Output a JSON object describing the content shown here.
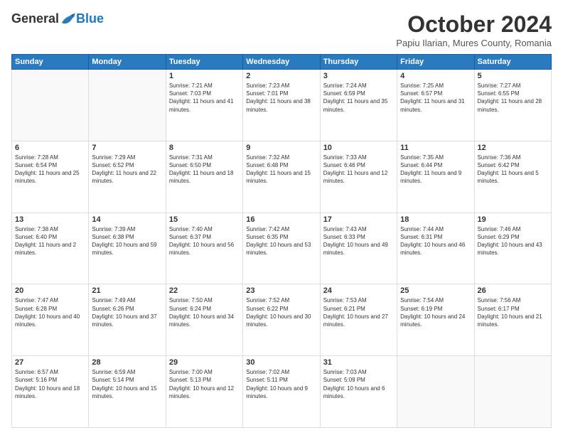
{
  "header": {
    "logo_general": "General",
    "logo_blue": "Blue",
    "month_title": "October 2024",
    "subtitle": "Papiu Ilarian, Mures County, Romania"
  },
  "weekdays": [
    "Sunday",
    "Monday",
    "Tuesday",
    "Wednesday",
    "Thursday",
    "Friday",
    "Saturday"
  ],
  "weeks": [
    [
      {
        "day": "",
        "info": ""
      },
      {
        "day": "",
        "info": ""
      },
      {
        "day": "1",
        "info": "Sunrise: 7:21 AM\nSunset: 7:03 PM\nDaylight: 11 hours and 41 minutes."
      },
      {
        "day": "2",
        "info": "Sunrise: 7:23 AM\nSunset: 7:01 PM\nDaylight: 11 hours and 38 minutes."
      },
      {
        "day": "3",
        "info": "Sunrise: 7:24 AM\nSunset: 6:59 PM\nDaylight: 11 hours and 35 minutes."
      },
      {
        "day": "4",
        "info": "Sunrise: 7:25 AM\nSunset: 6:57 PM\nDaylight: 11 hours and 31 minutes."
      },
      {
        "day": "5",
        "info": "Sunrise: 7:27 AM\nSunset: 6:55 PM\nDaylight: 11 hours and 28 minutes."
      }
    ],
    [
      {
        "day": "6",
        "info": "Sunrise: 7:28 AM\nSunset: 6:54 PM\nDaylight: 11 hours and 25 minutes."
      },
      {
        "day": "7",
        "info": "Sunrise: 7:29 AM\nSunset: 6:52 PM\nDaylight: 11 hours and 22 minutes."
      },
      {
        "day": "8",
        "info": "Sunrise: 7:31 AM\nSunset: 6:50 PM\nDaylight: 11 hours and 18 minutes."
      },
      {
        "day": "9",
        "info": "Sunrise: 7:32 AM\nSunset: 6:48 PM\nDaylight: 11 hours and 15 minutes."
      },
      {
        "day": "10",
        "info": "Sunrise: 7:33 AM\nSunset: 6:46 PM\nDaylight: 11 hours and 12 minutes."
      },
      {
        "day": "11",
        "info": "Sunrise: 7:35 AM\nSunset: 6:44 PM\nDaylight: 11 hours and 9 minutes."
      },
      {
        "day": "12",
        "info": "Sunrise: 7:36 AM\nSunset: 6:42 PM\nDaylight: 11 hours and 5 minutes."
      }
    ],
    [
      {
        "day": "13",
        "info": "Sunrise: 7:38 AM\nSunset: 6:40 PM\nDaylight: 11 hours and 2 minutes."
      },
      {
        "day": "14",
        "info": "Sunrise: 7:39 AM\nSunset: 6:38 PM\nDaylight: 10 hours and 59 minutes."
      },
      {
        "day": "15",
        "info": "Sunrise: 7:40 AM\nSunset: 6:37 PM\nDaylight: 10 hours and 56 minutes."
      },
      {
        "day": "16",
        "info": "Sunrise: 7:42 AM\nSunset: 6:35 PM\nDaylight: 10 hours and 53 minutes."
      },
      {
        "day": "17",
        "info": "Sunrise: 7:43 AM\nSunset: 6:33 PM\nDaylight: 10 hours and 49 minutes."
      },
      {
        "day": "18",
        "info": "Sunrise: 7:44 AM\nSunset: 6:31 PM\nDaylight: 10 hours and 46 minutes."
      },
      {
        "day": "19",
        "info": "Sunrise: 7:46 AM\nSunset: 6:29 PM\nDaylight: 10 hours and 43 minutes."
      }
    ],
    [
      {
        "day": "20",
        "info": "Sunrise: 7:47 AM\nSunset: 6:28 PM\nDaylight: 10 hours and 40 minutes."
      },
      {
        "day": "21",
        "info": "Sunrise: 7:49 AM\nSunset: 6:26 PM\nDaylight: 10 hours and 37 minutes."
      },
      {
        "day": "22",
        "info": "Sunrise: 7:50 AM\nSunset: 6:24 PM\nDaylight: 10 hours and 34 minutes."
      },
      {
        "day": "23",
        "info": "Sunrise: 7:52 AM\nSunset: 6:22 PM\nDaylight: 10 hours and 30 minutes."
      },
      {
        "day": "24",
        "info": "Sunrise: 7:53 AM\nSunset: 6:21 PM\nDaylight: 10 hours and 27 minutes."
      },
      {
        "day": "25",
        "info": "Sunrise: 7:54 AM\nSunset: 6:19 PM\nDaylight: 10 hours and 24 minutes."
      },
      {
        "day": "26",
        "info": "Sunrise: 7:56 AM\nSunset: 6:17 PM\nDaylight: 10 hours and 21 minutes."
      }
    ],
    [
      {
        "day": "27",
        "info": "Sunrise: 6:57 AM\nSunset: 5:16 PM\nDaylight: 10 hours and 18 minutes."
      },
      {
        "day": "28",
        "info": "Sunrise: 6:59 AM\nSunset: 5:14 PM\nDaylight: 10 hours and 15 minutes."
      },
      {
        "day": "29",
        "info": "Sunrise: 7:00 AM\nSunset: 5:13 PM\nDaylight: 10 hours and 12 minutes."
      },
      {
        "day": "30",
        "info": "Sunrise: 7:02 AM\nSunset: 5:11 PM\nDaylight: 10 hours and 9 minutes."
      },
      {
        "day": "31",
        "info": "Sunrise: 7:03 AM\nSunset: 5:09 PM\nDaylight: 10 hours and 6 minutes."
      },
      {
        "day": "",
        "info": ""
      },
      {
        "day": "",
        "info": ""
      }
    ]
  ]
}
